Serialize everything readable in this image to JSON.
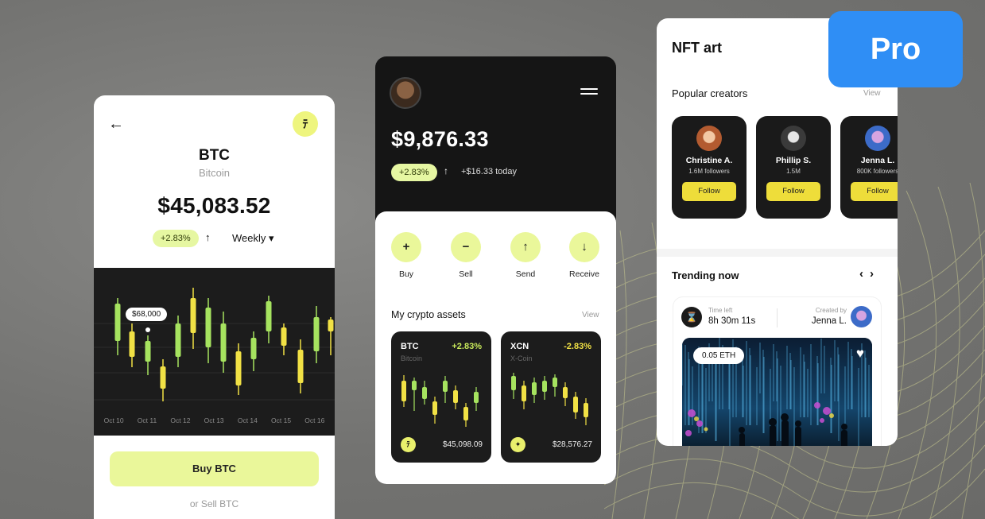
{
  "badge": {
    "label": "Pro",
    "color": "#2f8ef5"
  },
  "colors": {
    "accent": "#eaf79a",
    "candle_green": "#a6e35f",
    "candle_yellow": "#f1e145",
    "dark": "#151515",
    "negative": "#f1e145"
  },
  "btc_screen": {
    "back_icon": "arrow-left-icon",
    "coin_icon": "bitcoin-icon",
    "symbol": "BTC",
    "name": "Bitcoin",
    "price": "$45,083.52",
    "change": "+2.83%",
    "change_arrow": "↑",
    "period": "Weekly ▾",
    "tooltip": "$68,000",
    "x_labels": [
      "Oct 10",
      "Oct 11",
      "Oct 12",
      "Oct 13",
      "Oct 14",
      "Oct 15",
      "Oct 16"
    ],
    "buy_label": "Buy BTC",
    "sell_label": "or Sell BTC"
  },
  "wallet_screen": {
    "menu_icon": "hamburger-menu-icon",
    "balance": "$9,876.33",
    "change": "+2.83%",
    "change_arrow": "↑",
    "today": "+$16.33 today",
    "actions": [
      {
        "label": "Buy",
        "icon": "+"
      },
      {
        "label": "Sell",
        "icon": "−"
      },
      {
        "label": "Send",
        "icon": "↑"
      },
      {
        "label": "Receive",
        "icon": "↓"
      }
    ],
    "assets_title": "My crypto assets",
    "view_label": "View",
    "assets": [
      {
        "symbol": "BTC",
        "name": "Bitcoin",
        "change": "+2.83%",
        "value": "$45,098.09",
        "icon": "bitcoin-icon",
        "change_color": "#c9ea5b"
      },
      {
        "symbol": "XCN",
        "name": "X-Coin",
        "change": "-2.83%",
        "value": "$28,576.27",
        "icon": "xcoin-icon",
        "change_color": "#f1e145"
      }
    ]
  },
  "nft_screen": {
    "title": "NFT art",
    "popular_title": "Popular creators",
    "view_label": "View",
    "creators": [
      {
        "name": "Christine A.",
        "followers": "1.6M followers",
        "follow": "Follow"
      },
      {
        "name": "Phillip S.",
        "followers": "1.5M",
        "follow": "Follow"
      },
      {
        "name": "Jenna L.",
        "followers": "800K followers",
        "follow": "Follow"
      }
    ],
    "trending_title": "Trending now",
    "nav_prev": "‹",
    "nav_next": "›",
    "time_left_label": "Time left",
    "time_left": "8h 30m 11s",
    "created_by_label": "Created by",
    "creator": "Jenna L.",
    "price": "0.05 ETH"
  }
}
